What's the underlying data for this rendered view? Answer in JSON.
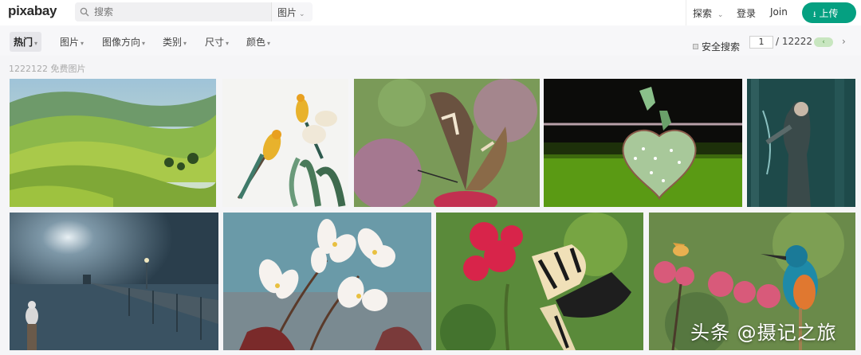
{
  "header": {
    "logo": "pixabay",
    "search_placeholder": "搜索",
    "search_scope": "图片",
    "explore": "探索",
    "login": "登录",
    "join": "Join",
    "upload": "上传"
  },
  "filters": {
    "items": [
      {
        "label": "热门",
        "active": true
      },
      {
        "label": "图片"
      },
      {
        "label": "图像方向"
      },
      {
        "label": "类别"
      },
      {
        "label": "尺寸"
      },
      {
        "label": "颜色"
      }
    ],
    "safe_search": "安全搜索",
    "page_current": "1",
    "page_total": "/ 12222"
  },
  "results": {
    "count_text": "1222122 免费图片"
  },
  "photos": [
    {
      "subject": "green hills landscape"
    },
    {
      "subject": "parrots illustration"
    },
    {
      "subject": "butterfly on pink flower"
    },
    {
      "subject": "heart ornament on rope"
    },
    {
      "subject": "warrior woman in forest"
    },
    {
      "subject": "pier at night"
    },
    {
      "subject": "white blossoms"
    },
    {
      "subject": "swallowtail butterfly on red flower"
    },
    {
      "subject": "kingfisher and butterfly"
    }
  ],
  "watermark": "头条 @摄记之旅"
}
